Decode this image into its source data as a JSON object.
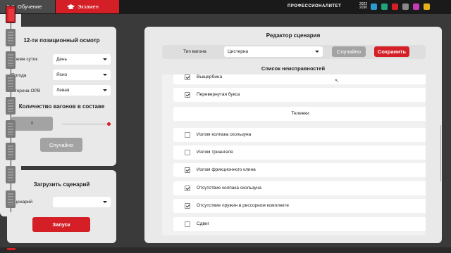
{
  "tabs": [
    {
      "label": "Обучение",
      "icon": "book-icon"
    },
    {
      "label": "Экзамен",
      "icon": "graduation-cap-icon"
    }
  ],
  "brand": {
    "name": "ПРОФЕССИОНАЛИТЕТ",
    "year_top": "2022",
    "year_bottom": "2030"
  },
  "inspection": {
    "title": "12-ти позиционный осмотр",
    "fields": [
      {
        "label": "Время суток",
        "value": "День"
      },
      {
        "label": "Погода",
        "value": "Ясно"
      },
      {
        "label": "Сторона ОРВ",
        "value": "Левая"
      }
    ],
    "cars_title": "Количество вагонов в составе",
    "cars_count": "8",
    "cars_slider_fraction": 1.0,
    "random_label": "Случайно"
  },
  "load": {
    "title": "Загрузить сценарий",
    "scenario_label": "Сценарий",
    "scenario_value": "",
    "start_label": "Запуск"
  },
  "rail": {
    "car_count": 9,
    "active_index": 0
  },
  "editor": {
    "title": "Редактор сценария",
    "wagon_type_label": "Тип вагона",
    "wagon_type_value": "Цистерна",
    "random_label": "Случайно",
    "save_label": "Сохранить",
    "list_title": "Список неисправностей",
    "rows": [
      {
        "text": "Выщербина",
        "checked": true,
        "section": false
      },
      {
        "text": "Перевернутая букса",
        "checked": true,
        "section": false
      },
      {
        "text": "Тележки",
        "checked": false,
        "section": true
      },
      {
        "text": "Излом колпака скользуна",
        "checked": false,
        "section": false
      },
      {
        "text": "Излом триангеля",
        "checked": false,
        "section": false
      },
      {
        "text": "Излом фрикционного клина",
        "checked": true,
        "section": false
      },
      {
        "text": "Отсутствие колпака скользуна",
        "checked": true,
        "section": false
      },
      {
        "text": "Отсутствие пружин в рессорном комплекте",
        "checked": true,
        "section": false
      },
      {
        "text": "Сдвиг",
        "checked": false,
        "section": false
      }
    ]
  },
  "colors": {
    "accent": "#d51f26",
    "panel": "#e9e9e9",
    "background": "#3a3a3a",
    "topbar": "#1a1a1a"
  }
}
